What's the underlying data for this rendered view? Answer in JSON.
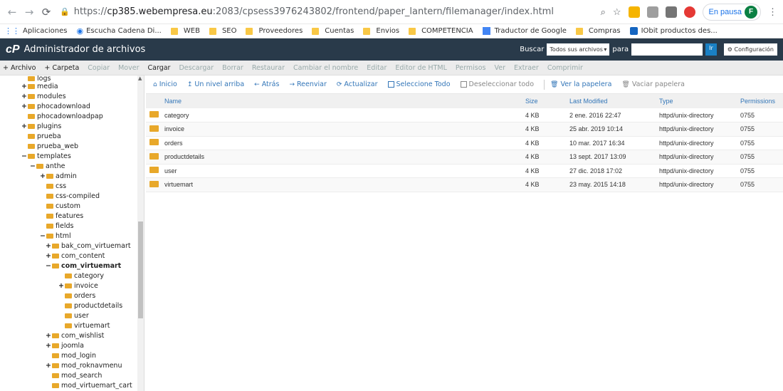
{
  "browser": {
    "url_scheme": "https://",
    "url_host": "cp385.webempresa.eu",
    "url_rest": ":2083/cpsess3976243802/frontend/paper_lantern/filemanager/index.html",
    "paused_label": "En pausa",
    "avatar_letter": "F"
  },
  "bookmarks": [
    {
      "label": "Aplicaciones",
      "kind": "grid"
    },
    {
      "label": "Escucha Cadena Di...",
      "kind": "radio"
    },
    {
      "label": "WEB",
      "kind": "folder"
    },
    {
      "label": "SEO",
      "kind": "folder"
    },
    {
      "label": "Proveedores",
      "kind": "folder"
    },
    {
      "label": "Cuentas",
      "kind": "folder"
    },
    {
      "label": "Envios",
      "kind": "folder"
    },
    {
      "label": "COMPETENCIA",
      "kind": "folder"
    },
    {
      "label": "Traductor de Google",
      "kind": "translate"
    },
    {
      "label": "Compras",
      "kind": "folder"
    },
    {
      "label": "IObit productos des...",
      "kind": "iobit"
    }
  ],
  "header": {
    "logo": "cP",
    "title": "Administrador de archivos",
    "search_label": "Buscar",
    "search_scope": "Todos sus archivos",
    "for_label": "para",
    "go_label": "Ir",
    "settings_label": "Configuración"
  },
  "toolbar": [
    {
      "label": "+ Archivo",
      "enabled": true
    },
    {
      "label": "+ Carpeta",
      "enabled": true
    },
    {
      "label": "Copiar",
      "enabled": false
    },
    {
      "label": "Mover",
      "enabled": false
    },
    {
      "label": "Cargar",
      "enabled": true
    },
    {
      "label": "Descargar",
      "enabled": false
    },
    {
      "label": "Borrar",
      "enabled": false
    },
    {
      "label": "Restaurar",
      "enabled": false
    },
    {
      "label": "Cambiar el nombre",
      "enabled": false
    },
    {
      "label": "Editar",
      "enabled": false
    },
    {
      "label": "Editor de HTML",
      "enabled": false
    },
    {
      "label": "Permisos",
      "enabled": false
    },
    {
      "label": "Ver",
      "enabled": false
    },
    {
      "label": "Extraer",
      "enabled": false
    },
    {
      "label": "Comprimir",
      "enabled": false
    }
  ],
  "tree": [
    {
      "label": "logs",
      "depth": 1,
      "toggle": ""
    },
    {
      "label": "media",
      "depth": 1,
      "toggle": "+"
    },
    {
      "label": "modules",
      "depth": 1,
      "toggle": "+"
    },
    {
      "label": "phocadownload",
      "depth": 1,
      "toggle": "+"
    },
    {
      "label": "phocadownloadpap",
      "depth": 1,
      "toggle": ""
    },
    {
      "label": "plugins",
      "depth": 1,
      "toggle": "+"
    },
    {
      "label": "prueba",
      "depth": 1,
      "toggle": ""
    },
    {
      "label": "prueba_web",
      "depth": 1,
      "toggle": ""
    },
    {
      "label": "templates",
      "depth": 1,
      "toggle": "−"
    },
    {
      "label": "anthe",
      "depth": 2,
      "toggle": "−"
    },
    {
      "label": "admin",
      "depth": 3,
      "toggle": "+"
    },
    {
      "label": "css",
      "depth": 3,
      "toggle": ""
    },
    {
      "label": "css-compiled",
      "depth": 3,
      "toggle": ""
    },
    {
      "label": "custom",
      "depth": 3,
      "toggle": ""
    },
    {
      "label": "features",
      "depth": 3,
      "toggle": ""
    },
    {
      "label": "fields",
      "depth": 3,
      "toggle": ""
    },
    {
      "label": "html",
      "depth": 3,
      "toggle": "−"
    },
    {
      "label": "bak_com_virtuemart",
      "depth": 4,
      "toggle": "+"
    },
    {
      "label": "com_content",
      "depth": 4,
      "toggle": "+"
    },
    {
      "label": "com_virtuemart",
      "depth": 4,
      "toggle": "−",
      "selected": true
    },
    {
      "label": "category",
      "depth": 5,
      "toggle": ""
    },
    {
      "label": "invoice",
      "depth": 5,
      "toggle": "+"
    },
    {
      "label": "orders",
      "depth": 5,
      "toggle": ""
    },
    {
      "label": "productdetails",
      "depth": 5,
      "toggle": ""
    },
    {
      "label": "user",
      "depth": 5,
      "toggle": ""
    },
    {
      "label": "virtuemart",
      "depth": 5,
      "toggle": ""
    },
    {
      "label": "com_wishlist",
      "depth": 4,
      "toggle": "+"
    },
    {
      "label": "joomla",
      "depth": 4,
      "toggle": "+"
    },
    {
      "label": "mod_login",
      "depth": 4,
      "toggle": ""
    },
    {
      "label": "mod_roknavmenu",
      "depth": 4,
      "toggle": "+"
    },
    {
      "label": "mod_search",
      "depth": 4,
      "toggle": ""
    },
    {
      "label": "mod_virtuemart_cart",
      "depth": 4,
      "toggle": ""
    }
  ],
  "actions": [
    {
      "label": "Inicio",
      "icon": "⌂",
      "enabled": true
    },
    {
      "label": "Un nivel arriba",
      "icon": "↥",
      "enabled": true
    },
    {
      "label": "Atrás",
      "icon": "←",
      "enabled": true
    },
    {
      "label": "Reenviar",
      "icon": "→",
      "enabled": true
    },
    {
      "label": "Actualizar",
      "icon": "⟳",
      "enabled": true
    },
    {
      "label": "Seleccione Todo",
      "icon": "checkbox",
      "enabled": true
    },
    {
      "label": "Deseleccionar todo",
      "icon": "checkbox",
      "enabled": false
    },
    {
      "label": "Ver la papelera",
      "icon": "🗑",
      "enabled": true
    },
    {
      "label": "Vaciar papelera",
      "icon": "🗑",
      "enabled": false
    }
  ],
  "columns": [
    "Name",
    "Size",
    "Last Modified",
    "Type",
    "Permissions"
  ],
  "files": [
    {
      "name": "category",
      "size": "4 KB",
      "modified": "2 ene. 2016 22:47",
      "type": "httpd/unix-directory",
      "perms": "0755"
    },
    {
      "name": "invoice",
      "size": "4 KB",
      "modified": "25 abr. 2019 10:14",
      "type": "httpd/unix-directory",
      "perms": "0755"
    },
    {
      "name": "orders",
      "size": "4 KB",
      "modified": "10 mar. 2017 16:34",
      "type": "httpd/unix-directory",
      "perms": "0755"
    },
    {
      "name": "productdetails",
      "size": "4 KB",
      "modified": "13 sept. 2017 13:09",
      "type": "httpd/unix-directory",
      "perms": "0755"
    },
    {
      "name": "user",
      "size": "4 KB",
      "modified": "27 dic. 2018 17:02",
      "type": "httpd/unix-directory",
      "perms": "0755"
    },
    {
      "name": "virtuemart",
      "size": "4 KB",
      "modified": "23 may. 2015 14:18",
      "type": "httpd/unix-directory",
      "perms": "0755"
    }
  ]
}
